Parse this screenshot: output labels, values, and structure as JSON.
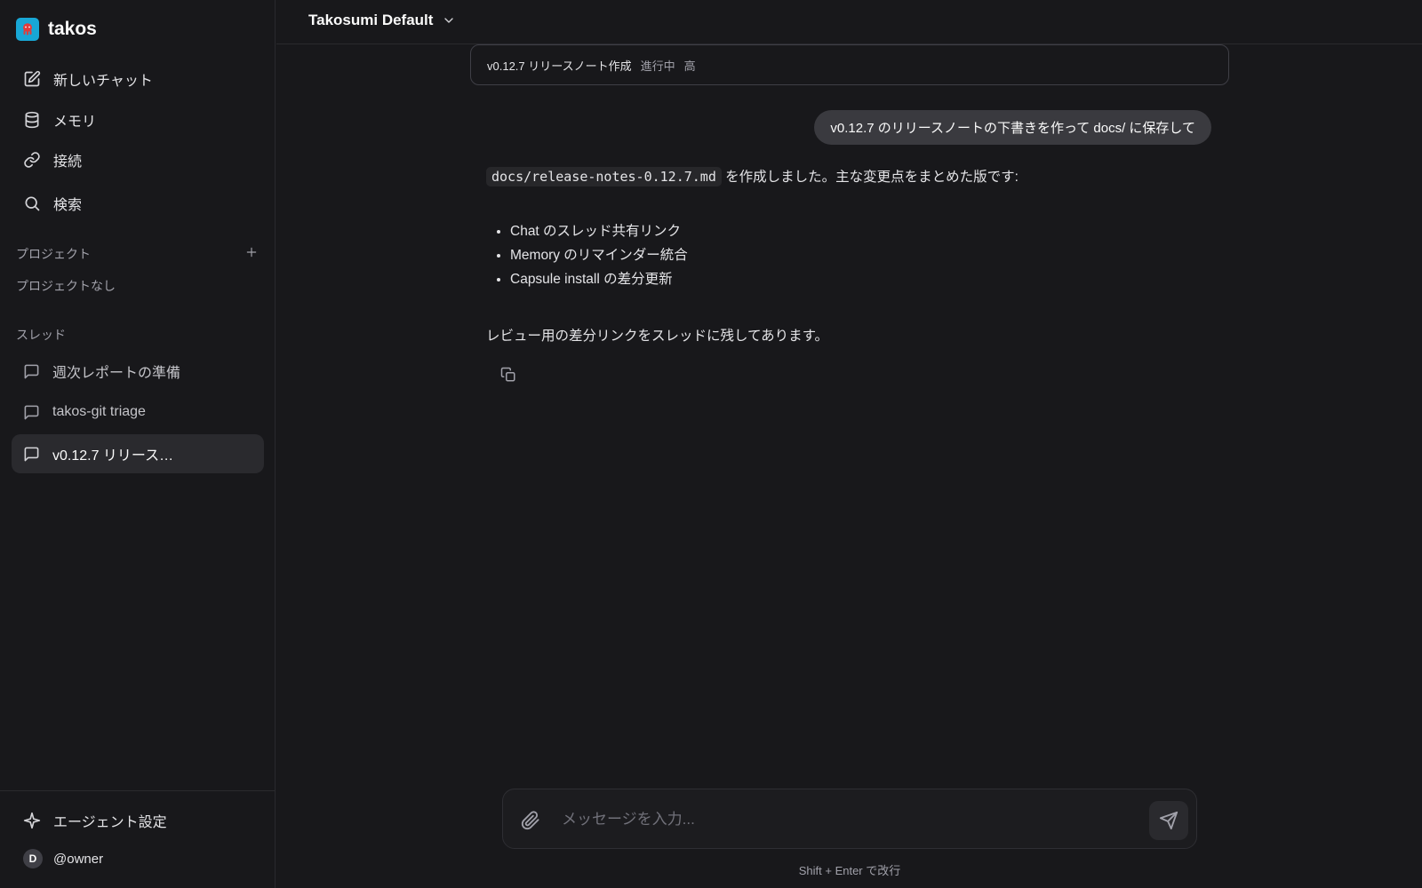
{
  "app": {
    "name": "takos",
    "logo_icon": "octopus-logo"
  },
  "sidebar": {
    "nav": [
      {
        "label": "新しいチャット",
        "icon": "edit-icon"
      },
      {
        "label": "メモリ",
        "icon": "database-icon"
      },
      {
        "label": "接続",
        "icon": "link-icon"
      },
      {
        "label": "検索",
        "icon": "search-icon"
      }
    ],
    "projects": {
      "title": "プロジェクト",
      "empty": "プロジェクトなし"
    },
    "threads": {
      "title": "スレッド",
      "items": [
        {
          "label": "週次レポートの準備"
        },
        {
          "label": "takos-git triage"
        },
        {
          "label": "v0.12.7 リリース…",
          "active": true
        }
      ]
    },
    "agent_settings": "エージェント設定",
    "user": {
      "initial": "D",
      "name": "@owner"
    }
  },
  "header": {
    "workspace": "Takosumi Default"
  },
  "task": {
    "title": "v0.12.7 リリースノート作成",
    "status": "進行中",
    "priority": "高"
  },
  "messages": {
    "user": "v0.12.7 のリリースノートの下書きを作って docs/ に保存して",
    "assistant": {
      "code": "docs/release-notes-0.12.7.md",
      "intro": " を作成しました。主な変更点をまとめた版です:",
      "bullets": [
        "Chat のスレッド共有リンク",
        "Memory のリマインダー統合",
        "Capsule install の差分更新"
      ],
      "closing": "レビュー用の差分リンクをスレッドに残してあります。"
    }
  },
  "composer": {
    "placeholder": "メッセージを入力...",
    "hint": "Shift + Enter で改行"
  },
  "colors": {
    "background": "#18181b",
    "active": "#2a2a2e",
    "accent": "#18a7d6",
    "bubble": "#3a3a3f"
  }
}
